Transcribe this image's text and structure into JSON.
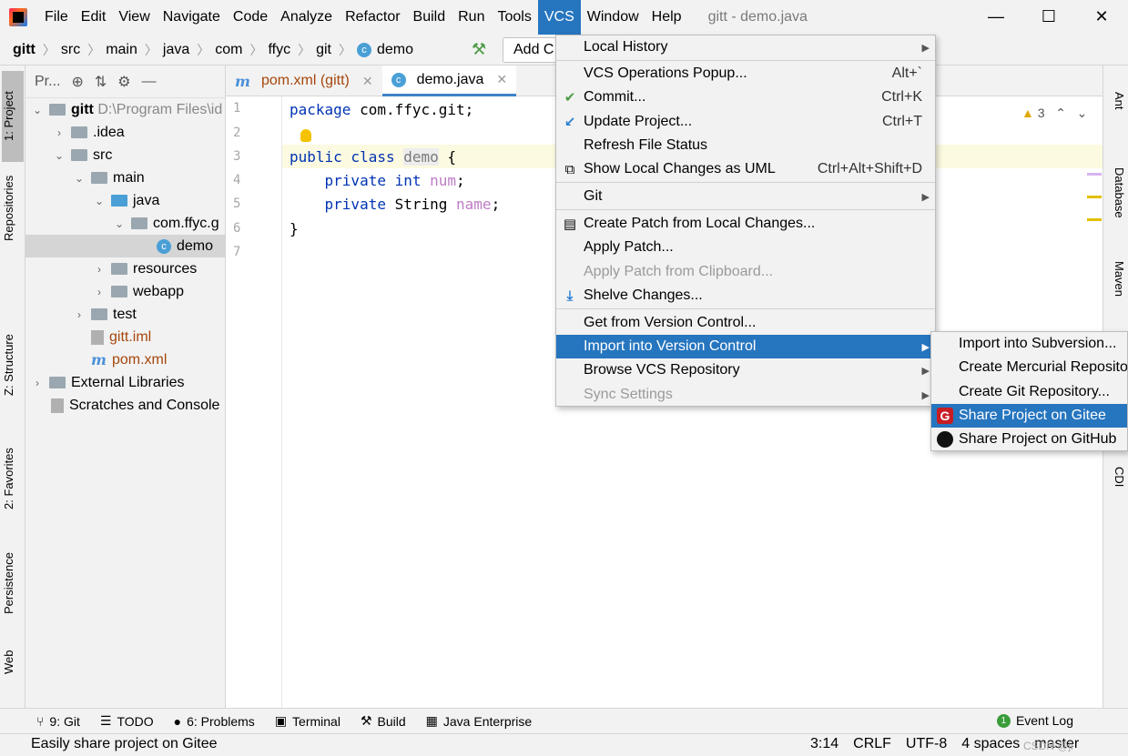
{
  "menubar": {
    "items": [
      "File",
      "Edit",
      "View",
      "Navigate",
      "Code",
      "Analyze",
      "Refactor",
      "Build",
      "Run",
      "Tools",
      "VCS",
      "Window",
      "Help"
    ],
    "window_title": "gitt - demo.java",
    "minimize": "—",
    "maximize": "☐",
    "close": "✕"
  },
  "navbar": {
    "crumbs": [
      "gitt",
      "src",
      "main",
      "java",
      "com",
      "ffyc",
      "git",
      "demo"
    ],
    "add_config": "Add C"
  },
  "left_strip": {
    "project": "1: Project",
    "repositories": "Repositories",
    "structure": "Z: Structure",
    "favorites": "2: Favorites",
    "persistence": "Persistence",
    "web": "Web"
  },
  "project_panel": {
    "header": "Pr...",
    "tree": [
      {
        "label": "gitt",
        "path": "D:\\Program Files\\id"
      },
      {
        "label": ".idea"
      },
      {
        "label": "src"
      },
      {
        "label": "main"
      },
      {
        "label": "java"
      },
      {
        "label": "com.ffyc.g"
      },
      {
        "label": "demo"
      },
      {
        "label": "resources"
      },
      {
        "label": "webapp"
      },
      {
        "label": "test"
      },
      {
        "label": "gitt.iml"
      },
      {
        "label": "pom.xml"
      },
      {
        "label": "External Libraries"
      },
      {
        "label": "Scratches and Console"
      }
    ]
  },
  "tabs": [
    {
      "label": "pom.xml (gitt)"
    },
    {
      "label": "demo.java"
    }
  ],
  "editor": {
    "line_numbers": [
      "1",
      "2",
      "3",
      "4",
      "5",
      "6",
      "7"
    ],
    "warnings": "3",
    "code": {
      "l1_kw": "package",
      "l1_rest": " com.ffyc.git;",
      "l3_kw": "public class ",
      "l3_cls": "demo",
      "l3_rest": " {",
      "l4_kw": "    private int ",
      "l4_fld": "num",
      "l4_rest": ";",
      "l5_kw": "    private ",
      "l5_type": "String ",
      "l5_fld": "name",
      "l5_rest": ";",
      "l6": "}"
    }
  },
  "right_strip": {
    "ant": "Ant",
    "database": "Database",
    "maven": "Maven",
    "cdi": "CDI"
  },
  "vcs_menu": {
    "local_history": "Local History",
    "vcs_popup": "VCS Operations Popup...",
    "vcs_popup_sc": "Alt+`",
    "commit": "Commit...",
    "commit_sc": "Ctrl+K",
    "update": "Update Project...",
    "update_sc": "Ctrl+T",
    "refresh": "Refresh File Status",
    "show_uml": "Show Local Changes as UML",
    "show_uml_sc": "Ctrl+Alt+Shift+D",
    "git": "Git",
    "create_patch": "Create Patch from Local Changes...",
    "apply_patch": "Apply Patch...",
    "apply_clip": "Apply Patch from Clipboard...",
    "shelve": "Shelve Changes...",
    "get_vc": "Get from Version Control...",
    "import_vc": "Import into Version Control",
    "browse": "Browse VCS Repository",
    "sync": "Sync Settings"
  },
  "sub_menu": {
    "svn": "Import into Subversion...",
    "mercurial": "Create Mercurial Repository",
    "git_repo": "Create Git Repository...",
    "gitee": "Share Project on Gitee",
    "github": "Share Project on GitHub"
  },
  "bottom_tools": {
    "git": "9: Git",
    "todo": "TODO",
    "problems": "6: Problems",
    "terminal": "Terminal",
    "build": "Build",
    "java_ent": "Java Enterprise",
    "event_log": "Event Log",
    "event_count": "1"
  },
  "status": {
    "message": "Easily share project on Gitee",
    "position": "3:14",
    "line_sep": "CRLF",
    "encoding": "UTF-8",
    "indent": "4 spaces",
    "branch": "master",
    "watermark": "CSDN @ji"
  }
}
